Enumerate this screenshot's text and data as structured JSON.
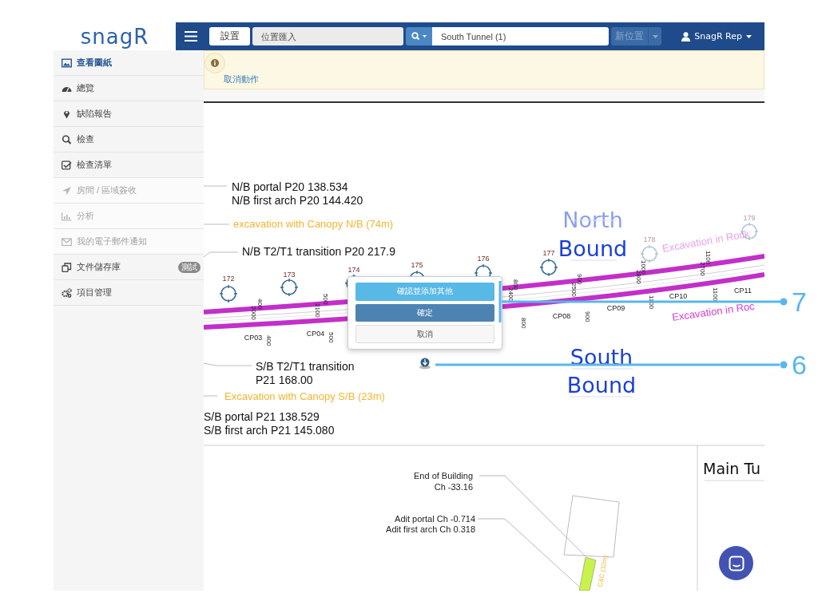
{
  "logo": "snagR",
  "toolbar": {
    "settings_button": "設置",
    "import_field": {
      "placeholder": "位置匯入"
    },
    "location_field": {
      "value": "South Tunnel (1)"
    },
    "new_location_button": "新位置",
    "new_location_disabled": true,
    "user": "SnagR Rep"
  },
  "sidebar": {
    "items": [
      {
        "label": "查看圖紙",
        "kind": "image",
        "selected": true,
        "dimmed": false
      },
      {
        "label": "總覽",
        "kind": "dashboard",
        "selected": false,
        "dimmed": false
      },
      {
        "label": "缺陷報告",
        "kind": "pin",
        "selected": false,
        "dimmed": false
      },
      {
        "label": "檢查",
        "kind": "search",
        "selected": false,
        "dimmed": false
      },
      {
        "label": "檢查清單",
        "kind": "checklist",
        "selected": false,
        "dimmed": false
      },
      {
        "label": "房間 / 區域簽收",
        "kind": "send",
        "selected": false,
        "dimmed": true
      },
      {
        "label": "分析",
        "kind": "chart",
        "selected": false,
        "dimmed": true
      },
      {
        "label": "我的電子郵件通知",
        "kind": "mail",
        "selected": false,
        "dimmed": true
      },
      {
        "label": "文件儲存庫",
        "kind": "files",
        "selected": false,
        "dimmed": false,
        "badge": "測試"
      },
      {
        "label": "項目管理",
        "kind": "cogs",
        "selected": false,
        "dimmed": false
      }
    ]
  },
  "alert": {
    "link": "取消動作"
  },
  "drawing": {
    "texts": [
      {
        "text": "N/B portal P20 138.534",
        "kind": "label",
        "faded": false
      },
      {
        "text": "N/B first arch P20 144.420",
        "kind": "label",
        "faded": false
      },
      {
        "text": "excavation with Canopy N/B  (74m)",
        "kind": "canopy",
        "faded": false
      },
      {
        "text": "N/B T2/T1 transition P20 217.9",
        "kind": "label",
        "faded": false
      },
      {
        "text": "North",
        "kind": "bound",
        "faded": true
      },
      {
        "text": "Bound",
        "kind": "bound",
        "faded": false
      },
      {
        "text": "Excavation in Rock",
        "kind": "rock",
        "faded": true
      },
      {
        "text": "172",
        "kind": "station",
        "faded": false
      },
      {
        "text": "173",
        "kind": "station",
        "faded": false
      },
      {
        "text": "174",
        "kind": "station",
        "faded": false
      },
      {
        "text": "175",
        "kind": "station",
        "faded": false
      },
      {
        "text": "176",
        "kind": "station",
        "faded": false
      },
      {
        "text": "177",
        "kind": "station",
        "faded": false
      },
      {
        "text": "178",
        "kind": "station",
        "faded": true
      },
      {
        "text": "179",
        "kind": "station",
        "faded": true
      },
      {
        "text": "CP03",
        "kind": "cp",
        "faded": false
      },
      {
        "text": "CP04",
        "kind": "cp",
        "faded": false
      },
      {
        "text": "CP08",
        "kind": "cp",
        "faded": false
      },
      {
        "text": "CP09",
        "kind": "cp",
        "faded": false
      },
      {
        "text": "CP10",
        "kind": "cp",
        "faded": false
      },
      {
        "text": "CP11",
        "kind": "cp",
        "faded": false
      },
      {
        "text": "Excavation in Roc",
        "kind": "rock",
        "faded": false
      },
      {
        "text": "South",
        "kind": "bound",
        "faded": false
      },
      {
        "text": "Bound",
        "kind": "bound",
        "faded": false
      },
      {
        "text": "S/B T2/T1 transition",
        "kind": "label",
        "faded": false
      },
      {
        "text": "P21 168.00",
        "kind": "label",
        "faded": false
      },
      {
        "text": "Excavation with Canopy S/B (23m)",
        "kind": "canopy",
        "faded": false
      },
      {
        "text": "S/B portal P21 138.529",
        "kind": "label",
        "faded": false
      },
      {
        "text": "S/B first arch P21 145.080",
        "kind": "label",
        "faded": false
      },
      {
        "text": "Main Tu",
        "kind": "title",
        "faded": false
      },
      {
        "text": "End of Building",
        "kind": "note",
        "faded": false
      },
      {
        "text": "Ch -33.16",
        "kind": "note",
        "faded": false
      },
      {
        "text": "Adit portal Ch -0.714",
        "kind": "note",
        "faded": false
      },
      {
        "text": "Adit first arch Ch 0.318",
        "kind": "note",
        "faded": false
      },
      {
        "text": "C&C (32m)",
        "kind": "small_canopy",
        "faded": false
      },
      {
        "text": "400",
        "kind": "dim",
        "faded": false
      },
      {
        "text": "2000",
        "kind": "dim",
        "faded": false
      },
      {
        "text": "500",
        "kind": "dim",
        "faded": false
      },
      {
        "text": "2100",
        "kind": "dim",
        "faded": false
      },
      {
        "text": "500",
        "kind": "dim",
        "faded": false
      },
      {
        "text": "400",
        "kind": "dim",
        "faded": false
      },
      {
        "text": "800",
        "kind": "dim",
        "faded": false
      },
      {
        "text": "2400",
        "kind": "dim",
        "faded": false
      },
      {
        "text": "800",
        "kind": "dim",
        "faded": false
      },
      {
        "text": "900",
        "kind": "dim",
        "faded": false
      },
      {
        "text": "2500",
        "kind": "dim",
        "faded": false
      },
      {
        "text": "900",
        "kind": "dim",
        "faded": false
      },
      {
        "text": "1000",
        "kind": "dim",
        "faded": false
      },
      {
        "text": "2800",
        "kind": "dim",
        "faded": false
      },
      {
        "text": "1100",
        "kind": "dim",
        "faded": false
      },
      {
        "text": "2700",
        "kind": "dim",
        "faded": false
      },
      {
        "text": "1100",
        "kind": "dim",
        "faded": false
      },
      {
        "text": "1100",
        "kind": "dim",
        "faded": false
      }
    ]
  },
  "popup": {
    "buttons": [
      {
        "label": "確認並添加其他",
        "kind": "add_another"
      },
      {
        "label": "確定",
        "kind": "confirm"
      },
      {
        "label": "取消",
        "kind": "cancel"
      }
    ]
  },
  "callouts": [
    {
      "label": "7"
    },
    {
      "label": "6"
    }
  ]
}
